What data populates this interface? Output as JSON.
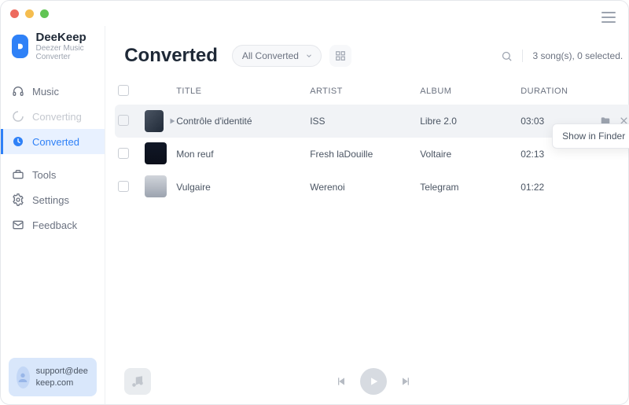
{
  "brand": {
    "name": "DeeKeep",
    "subtitle": "Deezer Music Converter"
  },
  "sidebar": {
    "items": [
      {
        "label": "Music"
      },
      {
        "label": "Converting"
      },
      {
        "label": "Converted"
      },
      {
        "label": "Tools"
      },
      {
        "label": "Settings"
      },
      {
        "label": "Feedback"
      }
    ]
  },
  "header": {
    "title": "Converted",
    "filter": "All Converted",
    "status": "3 song(s), 0 selected."
  },
  "columns": {
    "title": "TITLE",
    "artist": "ARTIST",
    "album": "ALBUM",
    "duration": "DURATION"
  },
  "tracks": [
    {
      "title": "Contrôle d'identité",
      "artist": "ISS",
      "album": "Libre 2.0",
      "duration": "03:03"
    },
    {
      "title": "Mon reuf",
      "artist": "Fresh laDouille",
      "album": "Voltaire",
      "duration": "02:13"
    },
    {
      "title": "Vulgaire",
      "artist": "Werenoi",
      "album": "Telegram",
      "duration": "01:22"
    }
  ],
  "tooltip": "Show in Finder",
  "support": "support@deekeep.com"
}
